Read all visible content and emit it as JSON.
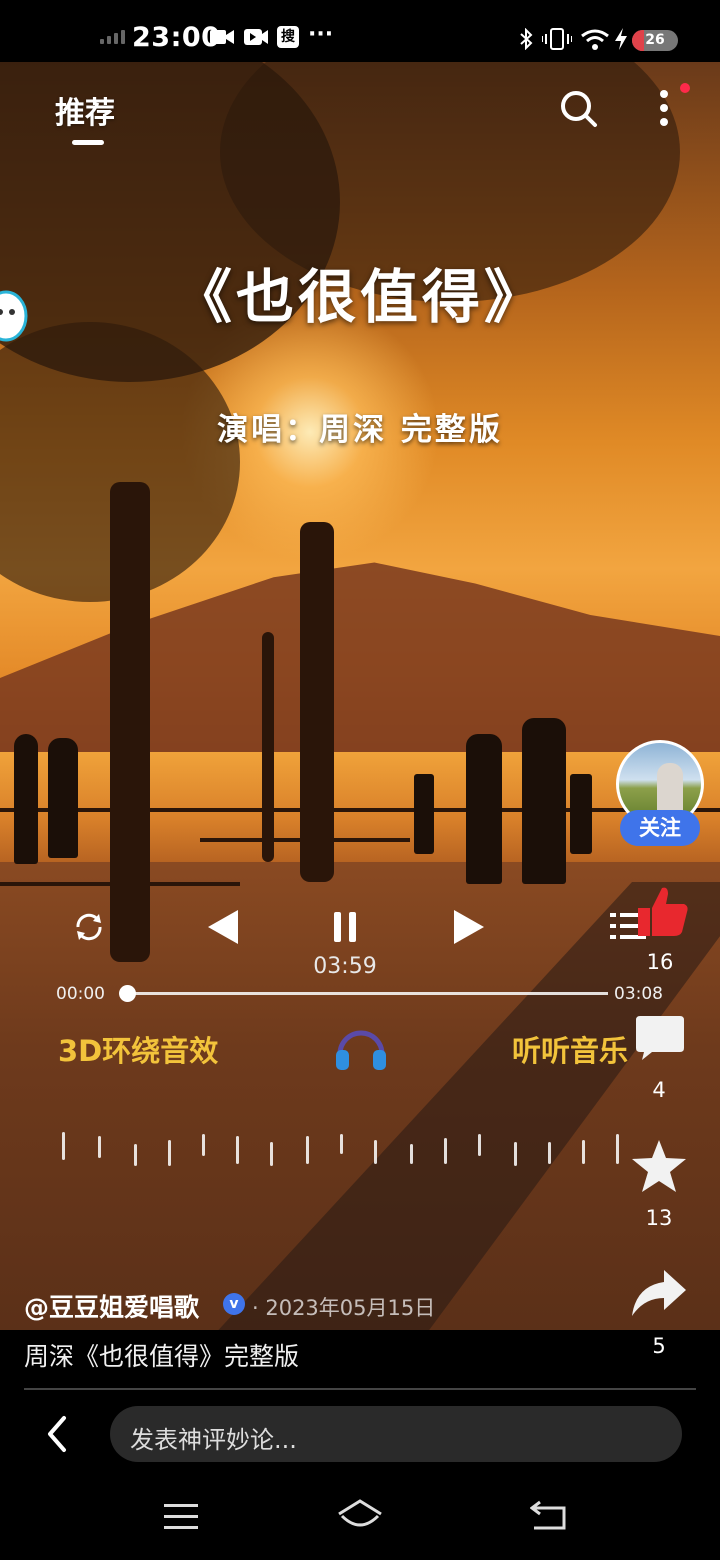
{
  "status_bar": {
    "time": "23:00",
    "search_badge": "搜",
    "dots": "···",
    "battery": "26"
  },
  "top_bar": {
    "tab_label": "推荐",
    "icons": [
      "search-icon",
      "more-vert-icon"
    ]
  },
  "video_overlay": {
    "song_title": "《也很值得》",
    "song_subtitle": "演唱：周深  完整版"
  },
  "player": {
    "duration_center": "03:59",
    "time_start": "00:00",
    "time_end": "03:08",
    "progress": 0.0,
    "sound_effect_label": "3D环绕音效",
    "listen_label": "听听音乐",
    "icons": [
      "repeat-icon",
      "previous-icon",
      "pause-icon",
      "next-icon",
      "playlist-icon",
      "headphone-icon"
    ]
  },
  "side_actions": {
    "follow_label": "关注",
    "like_count": "16",
    "comment_count": "4",
    "favorite_count": "13",
    "share_count": "5"
  },
  "post": {
    "author": "@豆豆姐爱唱歌",
    "date": "· 2023年05月15日",
    "caption": "周深《也很值得》完整版"
  },
  "comment_bar": {
    "placeholder": "发表神评妙论..."
  },
  "colors": {
    "accent_blue": "#3f74ea",
    "like_red": "#e8282e",
    "label_yellow": "#f2c33b"
  }
}
